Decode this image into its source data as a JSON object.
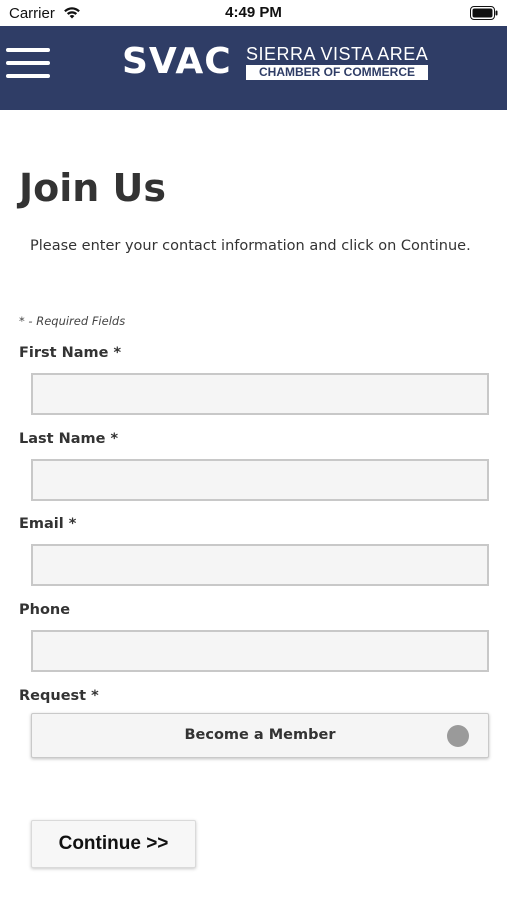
{
  "status_bar": {
    "carrier": "Carrier",
    "time": "4:49 PM",
    "wifi_icon": "wifi-icon",
    "battery_icon": "battery-icon"
  },
  "header": {
    "menu_icon": "hamburger-menu-icon",
    "background_color": "#2f3d66",
    "logo": {
      "abbreviation": "SVAC",
      "name": "SIERRA VISTA AREA",
      "subtitle": "CHAMBER OF COMMERCE"
    }
  },
  "page": {
    "title": "Join Us",
    "intro": "Please enter your contact information and click on Continue.",
    "required_note": "* - Required Fields"
  },
  "form": {
    "first_name": {
      "label": "First Name *",
      "value": ""
    },
    "last_name": {
      "label": "Last Name *",
      "value": ""
    },
    "email": {
      "label": "Email *",
      "value": ""
    },
    "phone": {
      "label": "Phone",
      "value": ""
    },
    "request": {
      "label": "Request *",
      "selected": "Become a Member"
    },
    "continue_label": "Continue >>"
  }
}
